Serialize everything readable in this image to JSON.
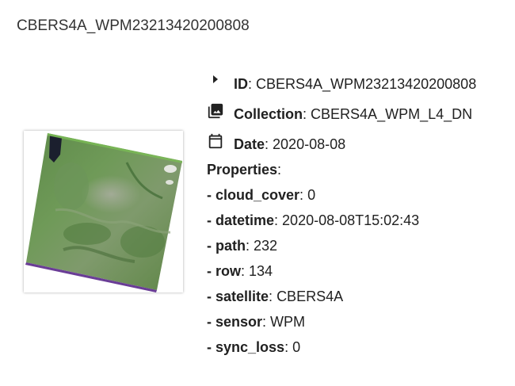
{
  "header": {
    "title": "CBERS4A_WPM23213420200808"
  },
  "thumbnail": {
    "alt": "CBERS4A_WPM23213420200808 preview"
  },
  "icons": {
    "id": "caret-right-icon",
    "collection": "photo-library-icon",
    "date": "calendar-icon"
  },
  "details": {
    "id": {
      "label": "ID",
      "value": "CBERS4A_WPM23213420200808"
    },
    "collection": {
      "label": "Collection",
      "value": "CBERS4A_WPM_L4_DN"
    },
    "date": {
      "label": "Date",
      "value": "2020-08-08"
    },
    "properties_label": "Properties",
    "properties": [
      {
        "key": "cloud_cover",
        "value": "0"
      },
      {
        "key": "datetime",
        "value": "2020-08-08T15:02:43"
      },
      {
        "key": "path",
        "value": "232"
      },
      {
        "key": "row",
        "value": "134"
      },
      {
        "key": "satellite",
        "value": "CBERS4A"
      },
      {
        "key": "sensor",
        "value": "WPM"
      },
      {
        "key": "sync_loss",
        "value": "0"
      }
    ]
  }
}
